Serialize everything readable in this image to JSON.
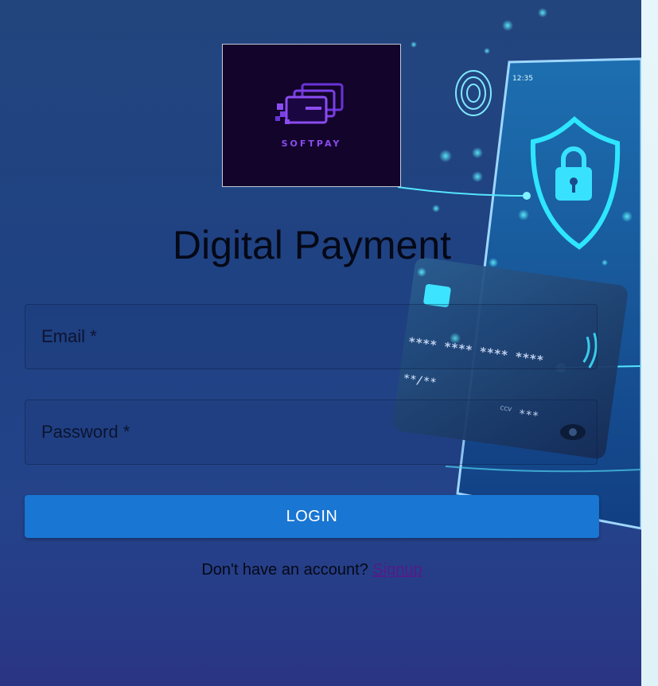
{
  "brand": {
    "logo_text": "SOFTPAY",
    "logo_color": "#8a4cf0"
  },
  "title": "Digital Payment",
  "form": {
    "email_label": "Email *",
    "password_label": "Password *",
    "login_label": "LOGIN"
  },
  "footer": {
    "prompt": "Don't have an account?",
    "signup_label": "Signup"
  },
  "decor": {
    "phone_time": "12:35",
    "card_number": "**** **** **** ****",
    "card_expiry": "**/**",
    "card_cvv_label": "CCV",
    "card_cvv": "***"
  },
  "colors": {
    "accent": "#1976d2",
    "link": "#551a8b",
    "background": "#1f4282"
  }
}
